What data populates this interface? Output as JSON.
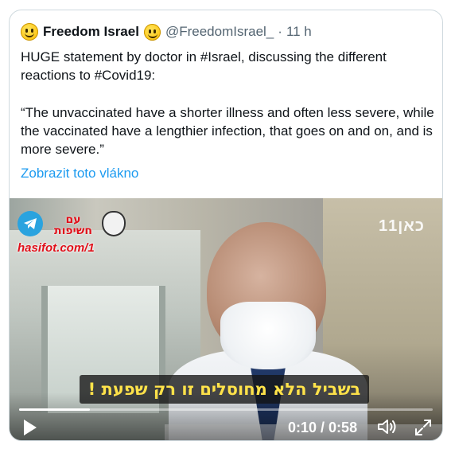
{
  "tweet": {
    "author_name": "Freedom Israel",
    "author_handle": "@FreedomIsrael_",
    "separator": "·",
    "timestamp": "11 h",
    "text_line1": "HUGE statement by doctor in #Israel, discussing the different reactions to #Covid19:",
    "text_quote": "“The unvaccinated have a shorter illness and often less severe, while the vaccinated have a lengthier infection, that goes on and on, and is more severe.”",
    "show_thread": "Zobrazit toto vlákno"
  },
  "video": {
    "watermark_hebrew": "עם\nחשיפות",
    "watermark_url": "hasifot.com/1",
    "channel_logo": "כאן11",
    "subtitle": "בשביל הלא מחוסלים זו רק שפעת !",
    "current_time": "0:10",
    "duration": "0:58",
    "time_separator": " / ",
    "progress": 0.172
  },
  "icons": {
    "avatar": "smiling-face-emoji",
    "name_emoji": "slightly-smiling-face-emoji",
    "play": "play-icon",
    "volume": "volume-icon",
    "fullscreen": "fullscreen-icon",
    "telegram": "telegram-icon"
  },
  "colors": {
    "link": "#1d9bf0",
    "secondary_text": "#536471",
    "subtitle_text": "#ffe34a",
    "watermark": "#e0101a"
  }
}
